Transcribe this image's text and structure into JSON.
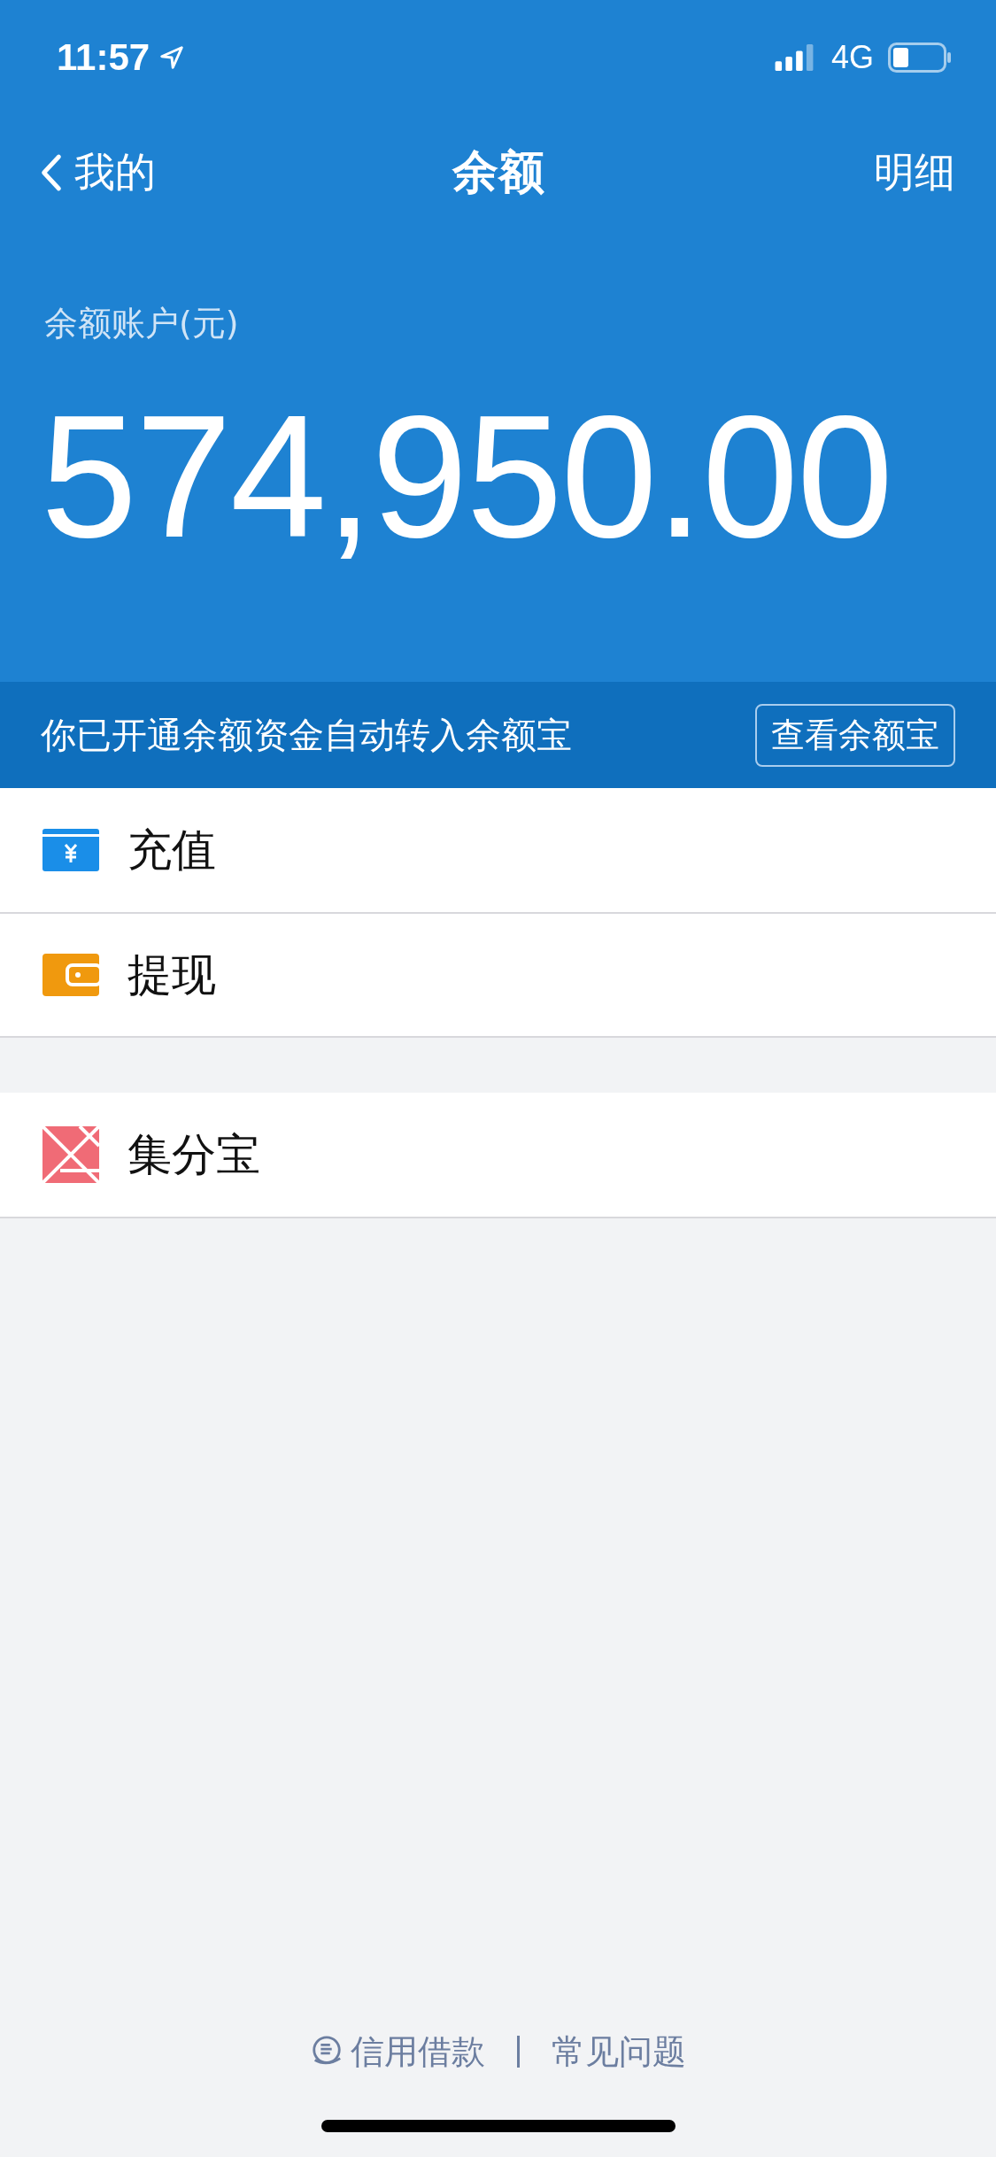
{
  "status_bar": {
    "time": "11:57",
    "network": "4G"
  },
  "nav": {
    "back_label": "我的",
    "title": "余额",
    "action": "明细"
  },
  "balance": {
    "label": "余额账户(元)",
    "amount": "574,950.00"
  },
  "notice": {
    "text": "你已开通余额资金自动转入余额宝",
    "button": "查看余额宝"
  },
  "menu_groups": [
    [
      {
        "kind": "card",
        "label": "充值"
      },
      {
        "kind": "wallet",
        "label": "提现"
      }
    ],
    [
      {
        "kind": "points",
        "label": "集分宝"
      }
    ]
  ],
  "footer_links": [
    {
      "kind": "loan",
      "label": "信用借款"
    },
    {
      "kind": "plain",
      "label": "常见问题"
    }
  ]
}
